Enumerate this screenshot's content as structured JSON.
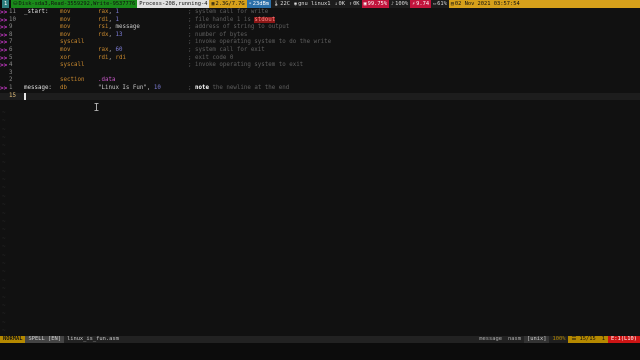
{
  "topbar": {
    "workspaces": [
      "1",
      "2",
      "3",
      "4",
      "5"
    ],
    "disk": "Disk-sda3,Read-3559292,Write-9537776",
    "process": "Process-208,running-4",
    "memory": "2.3G/7.7G",
    "wifi": "23dBm",
    "temp": "22C",
    "kernel": "gnu linux1",
    "net": "0K",
    "upload": "0K",
    "cpu": "99.75%",
    "volume": "100%",
    "battery_time": "9.74",
    "battery": "61%",
    "datetime": "02 Nov 2021 03:57:54"
  },
  "lines": [
    {
      "num": "11",
      "label": "_start:",
      "op": "mov",
      "args": [
        {
          "t": "reg",
          "v": "rax"
        },
        {
          "t": "p",
          "v": ", "
        },
        {
          "t": "num",
          "v": "1"
        }
      ],
      "comment": "; system call for write",
      "mark": ">>"
    },
    {
      "num": "10",
      "label": "",
      "op": "mov",
      "args": [
        {
          "t": "reg",
          "v": "rdi"
        },
        {
          "t": "p",
          "v": ", "
        },
        {
          "t": "num",
          "v": "1"
        }
      ],
      "comment_pre": "; file handle 1 is ",
      "comment_err": "stdout",
      "mark": ">>"
    },
    {
      "num": "9",
      "label": "",
      "op": "mov",
      "args": [
        {
          "t": "reg",
          "v": "rsi"
        },
        {
          "t": "p",
          "v": ", "
        },
        {
          "t": "str",
          "v": "message"
        }
      ],
      "comment": "; address of string to output",
      "mark": ">>"
    },
    {
      "num": "8",
      "label": "",
      "op": "mov",
      "args": [
        {
          "t": "reg",
          "v": "rdx"
        },
        {
          "t": "p",
          "v": ", "
        },
        {
          "t": "num",
          "v": "13"
        }
      ],
      "comment": "; number of bytes",
      "mark": ">>"
    },
    {
      "num": "7",
      "label": "",
      "op": "syscall",
      "args": [],
      "comment": "; invoke operating system to do the write",
      "mark": ">>"
    },
    {
      "num": "6",
      "label": "",
      "op": "mov",
      "args": [
        {
          "t": "reg",
          "v": "rax"
        },
        {
          "t": "p",
          "v": ", "
        },
        {
          "t": "num",
          "v": "60"
        }
      ],
      "comment": "; system call for exit",
      "mark": ">>"
    },
    {
      "num": "5",
      "label": "",
      "op": "xor",
      "args": [
        {
          "t": "reg",
          "v": "rdi"
        },
        {
          "t": "p",
          "v": ", "
        },
        {
          "t": "reg",
          "v": "rdi"
        }
      ],
      "comment": "; exit code 0",
      "mark": ">>"
    },
    {
      "num": "4",
      "label": "",
      "op": "syscall",
      "args": [],
      "comment": "; invoke operating system to exit",
      "mark": ">>"
    },
    {
      "num": "3",
      "label": "",
      "op": "",
      "args": [],
      "comment": "",
      "mark": ""
    },
    {
      "num": "2",
      "label": "",
      "op": "section",
      "args": [
        {
          "t": "dir",
          "v": ".data"
        }
      ],
      "comment": "",
      "mark": ""
    },
    {
      "num": "1",
      "label": "message:",
      "op": "db",
      "args": [
        {
          "t": "str",
          "v": "\"Linux Is Fun\""
        },
        {
          "t": "p",
          "v": ", "
        },
        {
          "t": "num",
          "v": "10"
        }
      ],
      "comment_todo": "note",
      "comment": " the newline at the end",
      "mark": ">>"
    },
    {
      "num": "15",
      "label": "",
      "op": "",
      "args": [],
      "comment": "",
      "mark": "",
      "current": true
    }
  ],
  "tilde_count": 27,
  "statusline": {
    "mode": "NORMAL",
    "spell": "SPELL [EN]",
    "filename": "linux_is_fun.asm",
    "filetype": "nasm",
    "encoding": "[unix]",
    "percent": "100%",
    "position": "15/15",
    "column": "1",
    "errors": "E:1(L10)"
  },
  "message_label": "message",
  "colors": {
    "mode_bg": "#b58900",
    "error_bg": "#cc1414",
    "marker": "#d23ad2"
  }
}
